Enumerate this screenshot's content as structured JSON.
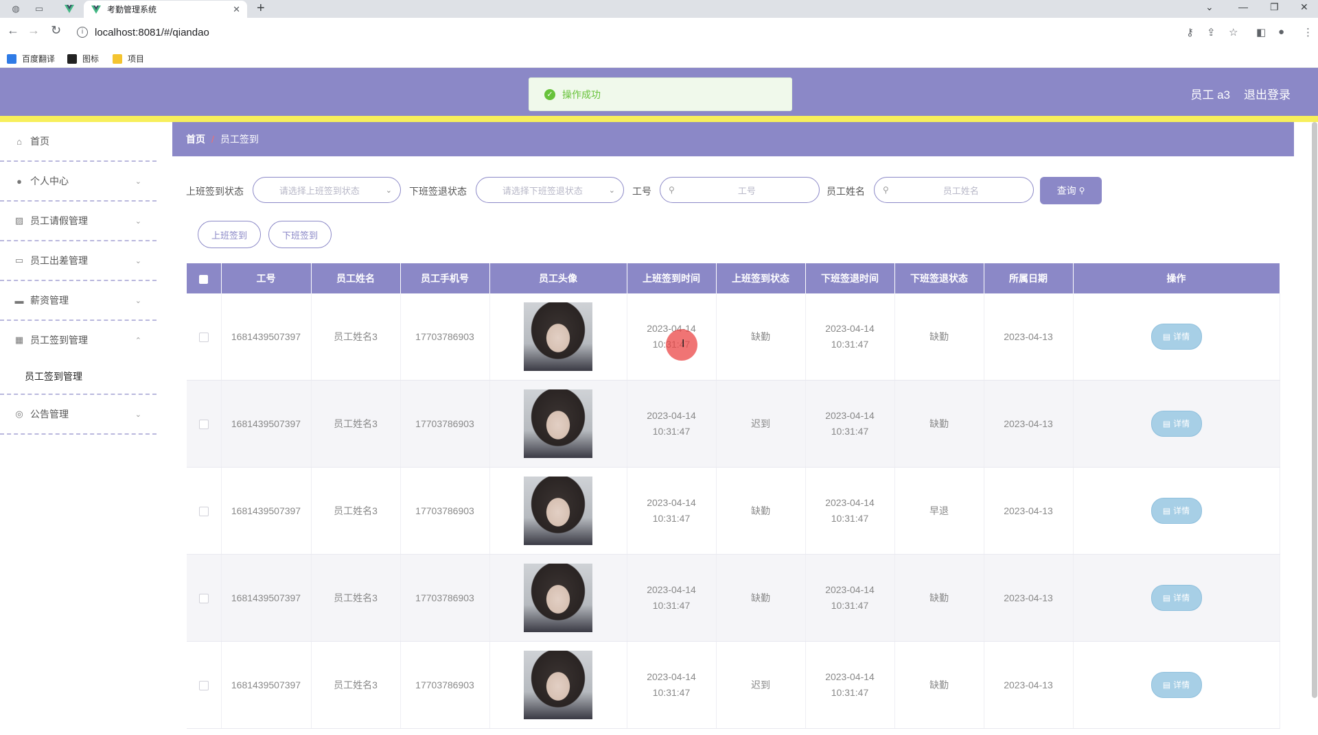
{
  "browser": {
    "tab_title": "考勤管理系统",
    "url": "localhost:8081/#/qiandao",
    "bookmarks": [
      "百度翻译",
      "图标",
      "项目"
    ]
  },
  "header": {
    "user_label": "员工 a3",
    "logout_label": "退出登录",
    "toast_text": "操作成功"
  },
  "sidebar": {
    "items": [
      {
        "label": "首页",
        "icon": "home-icon"
      },
      {
        "label": "个人中心",
        "icon": "user-icon"
      },
      {
        "label": "员工请假管理",
        "icon": "chart-icon"
      },
      {
        "label": "员工出差管理",
        "icon": "chat-icon"
      },
      {
        "label": "薪资管理",
        "icon": "monitor-icon"
      },
      {
        "label": "员工签到管理",
        "icon": "grid-icon"
      }
    ],
    "sub_item": "员工签到管理",
    "last_item": {
      "label": "公告管理",
      "icon": "compass-icon"
    }
  },
  "breadcrumb": {
    "home": "首页",
    "sep": "/",
    "current": "员工签到"
  },
  "filters": {
    "checkin_status_label": "上班签到状态",
    "checkin_status_placeholder": "请选择上班签到状态",
    "checkout_status_label": "下班签退状态",
    "checkout_status_placeholder": "请选择下班签退状态",
    "emp_no_label": "工号",
    "emp_no_placeholder": "工号",
    "emp_name_label": "员工姓名",
    "emp_name_placeholder": "员工姓名",
    "query_label": "查询"
  },
  "actions": {
    "checkin_label": "上班签到",
    "checkout_label": "下班签到"
  },
  "table": {
    "headers": [
      "工号",
      "员工姓名",
      "员工手机号",
      "员工头像",
      "上班签到时间",
      "上班签到状态",
      "下班签退时间",
      "下班签退状态",
      "所属日期",
      "操作"
    ],
    "rows": [
      {
        "no": "1681439507397",
        "name": "员工姓名3",
        "phone": "17703786903",
        "in_time": "2023-04-14 10:31:47",
        "in_status": "缺勤",
        "out_time": "2023-04-14 10:31:47",
        "out_status": "缺勤",
        "date": "2023-04-13",
        "action": "详情"
      },
      {
        "no": "1681439507397",
        "name": "员工姓名3",
        "phone": "17703786903",
        "in_time": "2023-04-14 10:31:47",
        "in_status": "迟到",
        "out_time": "2023-04-14 10:31:47",
        "out_status": "缺勤",
        "date": "2023-04-13",
        "action": "详情"
      },
      {
        "no": "1681439507397",
        "name": "员工姓名3",
        "phone": "17703786903",
        "in_time": "2023-04-14 10:31:47",
        "in_status": "缺勤",
        "out_time": "2023-04-14 10:31:47",
        "out_status": "早退",
        "date": "2023-04-13",
        "action": "详情"
      },
      {
        "no": "1681439507397",
        "name": "员工姓名3",
        "phone": "17703786903",
        "in_time": "2023-04-14 10:31:47",
        "in_status": "缺勤",
        "out_time": "2023-04-14 10:31:47",
        "out_status": "缺勤",
        "date": "2023-04-13",
        "action": "详情"
      },
      {
        "no": "1681439507397",
        "name": "员工姓名3",
        "phone": "17703786903",
        "in_time": "2023-04-14 10:31:47",
        "in_status": "迟到",
        "out_time": "2023-04-14 10:31:47",
        "out_status": "缺勤",
        "date": "2023-04-13",
        "action": "详情"
      }
    ]
  },
  "colors": {
    "theme": "#8b88c7",
    "accent_stripe": "#f7ef5b",
    "success": "#67c23a",
    "detail_button": "#a7cfe6"
  }
}
